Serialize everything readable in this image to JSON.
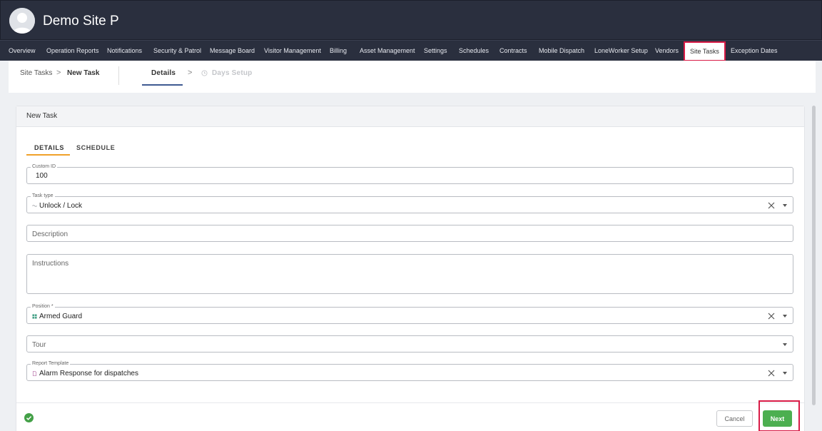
{
  "header": {
    "site_name": "Demo Site P"
  },
  "nav": {
    "items": [
      "Overview",
      "Operation Reports",
      "Notifications",
      "Security & Patrol",
      "Message Board",
      "Visitor Management",
      "Billing",
      "Asset Management",
      "Settings",
      "Schedules",
      "Contracts",
      "Mobile Dispatch",
      "LoneWorker Setup",
      "Vendors",
      "Site Tasks",
      "Exception Dates"
    ],
    "active": "Site Tasks"
  },
  "breadcrumb": {
    "parent": "Site Tasks",
    "separator": ">",
    "current": "New Task"
  },
  "steps": {
    "details": "Details",
    "separator": ">",
    "days_setup": "Days Setup"
  },
  "card": {
    "title": "New Task",
    "tabs": {
      "details": "DETAILS",
      "schedule": "SCHEDULE"
    }
  },
  "form": {
    "custom_id": {
      "label": "Custom ID",
      "value": "100"
    },
    "task_type": {
      "label": "Task type",
      "value": "Unlock / Lock"
    },
    "description": {
      "placeholder": "Description"
    },
    "instructions": {
      "placeholder": "Instructions"
    },
    "position": {
      "label": "Position *",
      "value": "Armed Guard"
    },
    "tour": {
      "placeholder": "Tour"
    },
    "report_template": {
      "label": "Report Template",
      "value": "Alarm Response for dispatches"
    }
  },
  "footer": {
    "cancel_label": "Cancel",
    "next_label": "Next"
  },
  "colors": {
    "header_bg": "#2a2f3e",
    "accent_tab": "#f0a12a",
    "step_underline": "#3f5a92",
    "next_button": "#4caf50",
    "highlight": "#d81b46"
  }
}
